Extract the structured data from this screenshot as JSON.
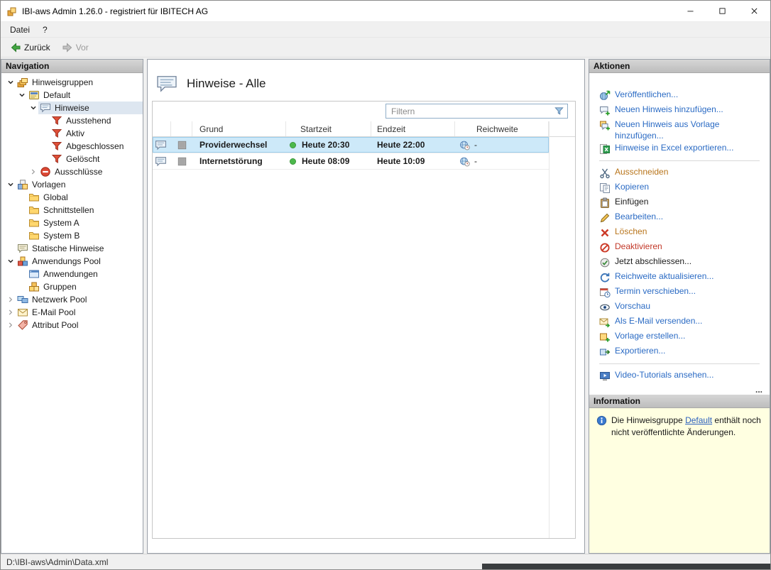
{
  "colors": {
    "link": "#2b6bc4",
    "amber": "#b8741a",
    "red": "#c23828",
    "plain": "#1a1a1a",
    "row_selection": "#cde9f9",
    "tree_selection": "#dde6f0",
    "info_bg": "#ffffe1"
  },
  "window": {
    "title": "IBI-aws Admin 1.26.0 - registriert für IBITECH AG"
  },
  "menu": {
    "items": [
      {
        "label": "Datei"
      },
      {
        "label": "?"
      }
    ]
  },
  "toolbar": {
    "back": "Zurück",
    "forward": "Vor"
  },
  "navigation": {
    "header": "Navigation",
    "items": [
      {
        "label": "Hinweisgruppen",
        "level": 0,
        "expander": "expanded",
        "icon": "notice-groups-icon"
      },
      {
        "label": "Default",
        "level": 1,
        "expander": "expanded",
        "icon": "notice-group-icon"
      },
      {
        "label": "Hinweise",
        "level": 2,
        "expander": "expanded",
        "icon": "notices-icon",
        "selected": true
      },
      {
        "label": "Ausstehend",
        "level": 3,
        "expander": "none",
        "icon": "filter-icon"
      },
      {
        "label": "Aktiv",
        "level": 3,
        "expander": "none",
        "icon": "filter-icon"
      },
      {
        "label": "Abgeschlossen",
        "level": 3,
        "expander": "none",
        "icon": "filter-icon"
      },
      {
        "label": "Gelöscht",
        "level": 3,
        "expander": "none",
        "icon": "filter-icon"
      },
      {
        "label": "Ausschlüsse",
        "level": 2,
        "expander": "collapsed",
        "icon": "exclusions-icon"
      },
      {
        "label": "Vorlagen",
        "level": 0,
        "expander": "expanded",
        "icon": "templates-icon"
      },
      {
        "label": "Global",
        "level": 1,
        "expander": "none",
        "icon": "folder-icon"
      },
      {
        "label": "Schnittstellen",
        "level": 1,
        "expander": "none",
        "icon": "folder-icon"
      },
      {
        "label": "System A",
        "level": 1,
        "expander": "none",
        "icon": "folder-icon"
      },
      {
        "label": "System B",
        "level": 1,
        "expander": "none",
        "icon": "folder-icon"
      },
      {
        "label": "Statische Hinweise",
        "level": 0,
        "expander": "none",
        "icon": "static-notices-icon"
      },
      {
        "label": "Anwendungs Pool",
        "level": 0,
        "expander": "expanded",
        "icon": "app-pool-icon"
      },
      {
        "label": "Anwendungen",
        "level": 1,
        "expander": "none",
        "icon": "applications-icon"
      },
      {
        "label": "Gruppen",
        "level": 1,
        "expander": "none",
        "icon": "groups-icon"
      },
      {
        "label": "Netzwerk Pool",
        "level": 0,
        "expander": "collapsed",
        "icon": "network-pool-icon"
      },
      {
        "label": "E-Mail Pool",
        "level": 0,
        "expander": "collapsed",
        "icon": "email-pool-icon"
      },
      {
        "label": "Attribut Pool",
        "level": 0,
        "expander": "collapsed",
        "icon": "attribute-pool-icon"
      }
    ]
  },
  "main": {
    "title": "Hinweise - Alle",
    "title_icon": "notices-large-icon",
    "filter": {
      "placeholder": "Filtern",
      "icon": "filter-funnel-icon"
    },
    "table": {
      "columns": [
        "",
        "",
        "Grund",
        "Startzeit",
        "Endzeit",
        "Reichweite"
      ],
      "rows": [
        {
          "icon": "notice-bubble-icon",
          "color_icon": "gray-square-icon",
          "grund": "Providerwechsel",
          "status_icon": "green-dot-icon",
          "startzeit": "Heute 20:30",
          "endzeit": "Heute 22:00",
          "reichweite_icon": "scope-globe-icon",
          "reichweite": "-",
          "selected": true
        },
        {
          "icon": "notice-bubble-icon",
          "color_icon": "gray-square-icon",
          "grund": "Internetstörung",
          "status_icon": "green-dot-icon",
          "startzeit": "Heute 08:09",
          "endzeit": "Heute 10:09",
          "reichweite_icon": "scope-globe-icon",
          "reichweite": "-",
          "selected": false
        }
      ]
    }
  },
  "actions": {
    "header": "Aktionen",
    "more": "...",
    "items": [
      {
        "label": "Veröffentlichen...",
        "icon": "publish-icon",
        "style": "link"
      },
      {
        "label": "Neuen Hinweis hinzufügen...",
        "icon": "add-notice-icon",
        "style": "link"
      },
      {
        "label": "Neuen Hinweis aus Vorlage hinzufügen...",
        "icon": "add-notice-from-template-icon",
        "style": "link"
      },
      {
        "label": "Hinweise in Excel exportieren...",
        "icon": "excel-export-icon",
        "style": "link",
        "separator_after": true
      },
      {
        "label": "Ausschneiden",
        "icon": "cut-icon",
        "style": "amber"
      },
      {
        "label": "Kopieren",
        "icon": "copy-icon",
        "style": "link"
      },
      {
        "label": "Einfügen",
        "icon": "paste-icon",
        "style": "plain"
      },
      {
        "label": "Bearbeiten...",
        "icon": "edit-icon",
        "style": "link"
      },
      {
        "label": "Löschen",
        "icon": "delete-icon",
        "style": "amber"
      },
      {
        "label": "Deaktivieren",
        "icon": "deactivate-icon",
        "style": "red"
      },
      {
        "label": "Jetzt abschliessen...",
        "icon": "finish-now-icon",
        "style": "plain"
      },
      {
        "label": "Reichweite aktualisieren...",
        "icon": "refresh-scope-icon",
        "style": "link"
      },
      {
        "label": "Termin verschieben...",
        "icon": "reschedule-icon",
        "style": "link"
      },
      {
        "label": "Vorschau",
        "icon": "preview-icon",
        "style": "link"
      },
      {
        "label": "Als E-Mail versenden...",
        "icon": "send-email-icon",
        "style": "link"
      },
      {
        "label": "Vorlage erstellen...",
        "icon": "create-template-icon",
        "style": "link"
      },
      {
        "label": "Exportieren...",
        "icon": "export-icon",
        "style": "link",
        "separator_after": true
      },
      {
        "label": "Video-Tutorials ansehen...",
        "icon": "video-tutorials-icon",
        "style": "link"
      }
    ]
  },
  "information": {
    "header": "Information",
    "icon": "info-icon",
    "text_before": "Die Hinweisgruppe ",
    "link": "Default",
    "text_after": " enthält noch nicht veröffentlichte Änderungen."
  },
  "statusbar": {
    "path": "D:\\IBI-aws\\Admin\\Data.xml"
  }
}
